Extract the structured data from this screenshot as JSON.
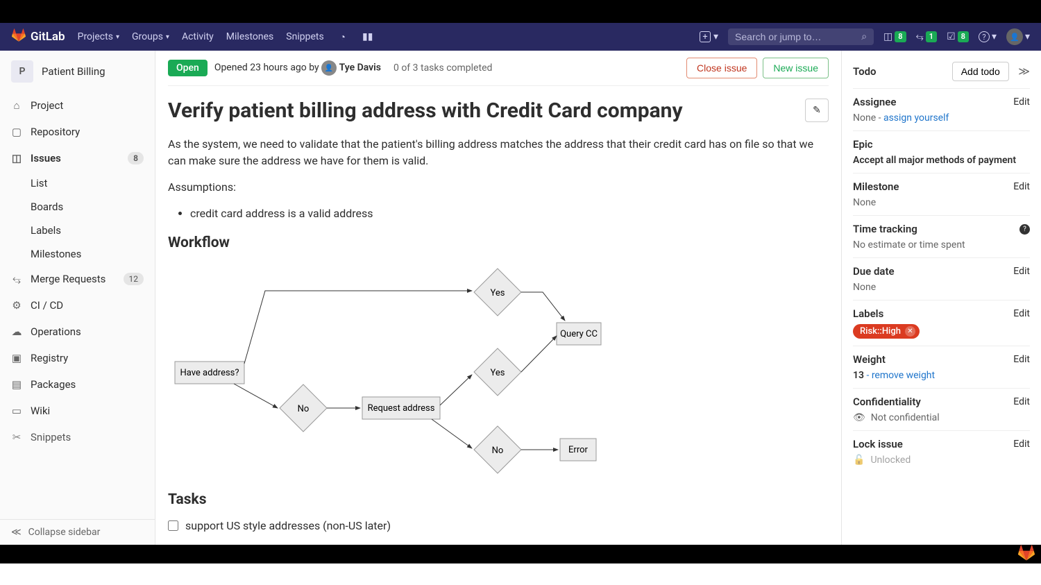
{
  "topnav": {
    "brand": "GitLab",
    "items": [
      "Projects",
      "Groups",
      "Activity",
      "Milestones",
      "Snippets"
    ],
    "search_placeholder": "Search or jump to…",
    "counters": {
      "issues": "8",
      "mrs": "1",
      "todos": "8"
    }
  },
  "project": {
    "initial": "P",
    "name": "Patient Billing"
  },
  "sidebar": {
    "project": "Project",
    "repository": "Repository",
    "issues": "Issues",
    "issues_count": "8",
    "list": "List",
    "boards": "Boards",
    "labels": "Labels",
    "milestones": "Milestones",
    "merge_requests": "Merge Requests",
    "mr_count": "12",
    "cicd": "CI / CD",
    "operations": "Operations",
    "registry": "Registry",
    "packages": "Packages",
    "wiki": "Wiki",
    "snippets": "Snippets",
    "collapse": "Collapse sidebar"
  },
  "issue": {
    "status": "Open",
    "opened": "Opened 23 hours ago by",
    "author": "Tye Davis",
    "tasks_progress": "0 of 3 tasks completed",
    "close_btn": "Close issue",
    "new_btn": "New issue",
    "title": "Verify patient billing address with Credit Card company",
    "description": "As the system, we need to validate that the patient's billing address matches the address that their credit card has on file so that we can make sure the address we have for them is valid.",
    "assumptions_h": "Assumptions:",
    "assumption1": "credit card address is a valid address",
    "workflow_h": "Workflow",
    "tasks_h": "Tasks",
    "task1": "support US style addresses (non-US later)"
  },
  "diagram": {
    "have_address": "Have address?",
    "yes": "Yes",
    "no": "No",
    "request_address": "Request address",
    "query_cc": "Query CC",
    "error": "Error"
  },
  "rside": {
    "todo": "Todo",
    "add_todo": "Add todo",
    "assignee": "Assignee",
    "assignee_none": "None - ",
    "assign_yourself": "assign yourself",
    "epic": "Epic",
    "epic_value": "Accept all major methods of payment",
    "milestone": "Milestone",
    "none": "None",
    "time_tracking": "Time tracking",
    "time_value": "No estimate or time spent",
    "due_date": "Due date",
    "labels": "Labels",
    "label_value": "Risk::High",
    "weight": "Weight",
    "weight_value": "13",
    "weight_remove": " - remove weight",
    "confidentiality": "Confidentiality",
    "conf_value": "Not confidential",
    "lock": "Lock issue",
    "lock_value": "Unlocked",
    "edit": "Edit"
  }
}
